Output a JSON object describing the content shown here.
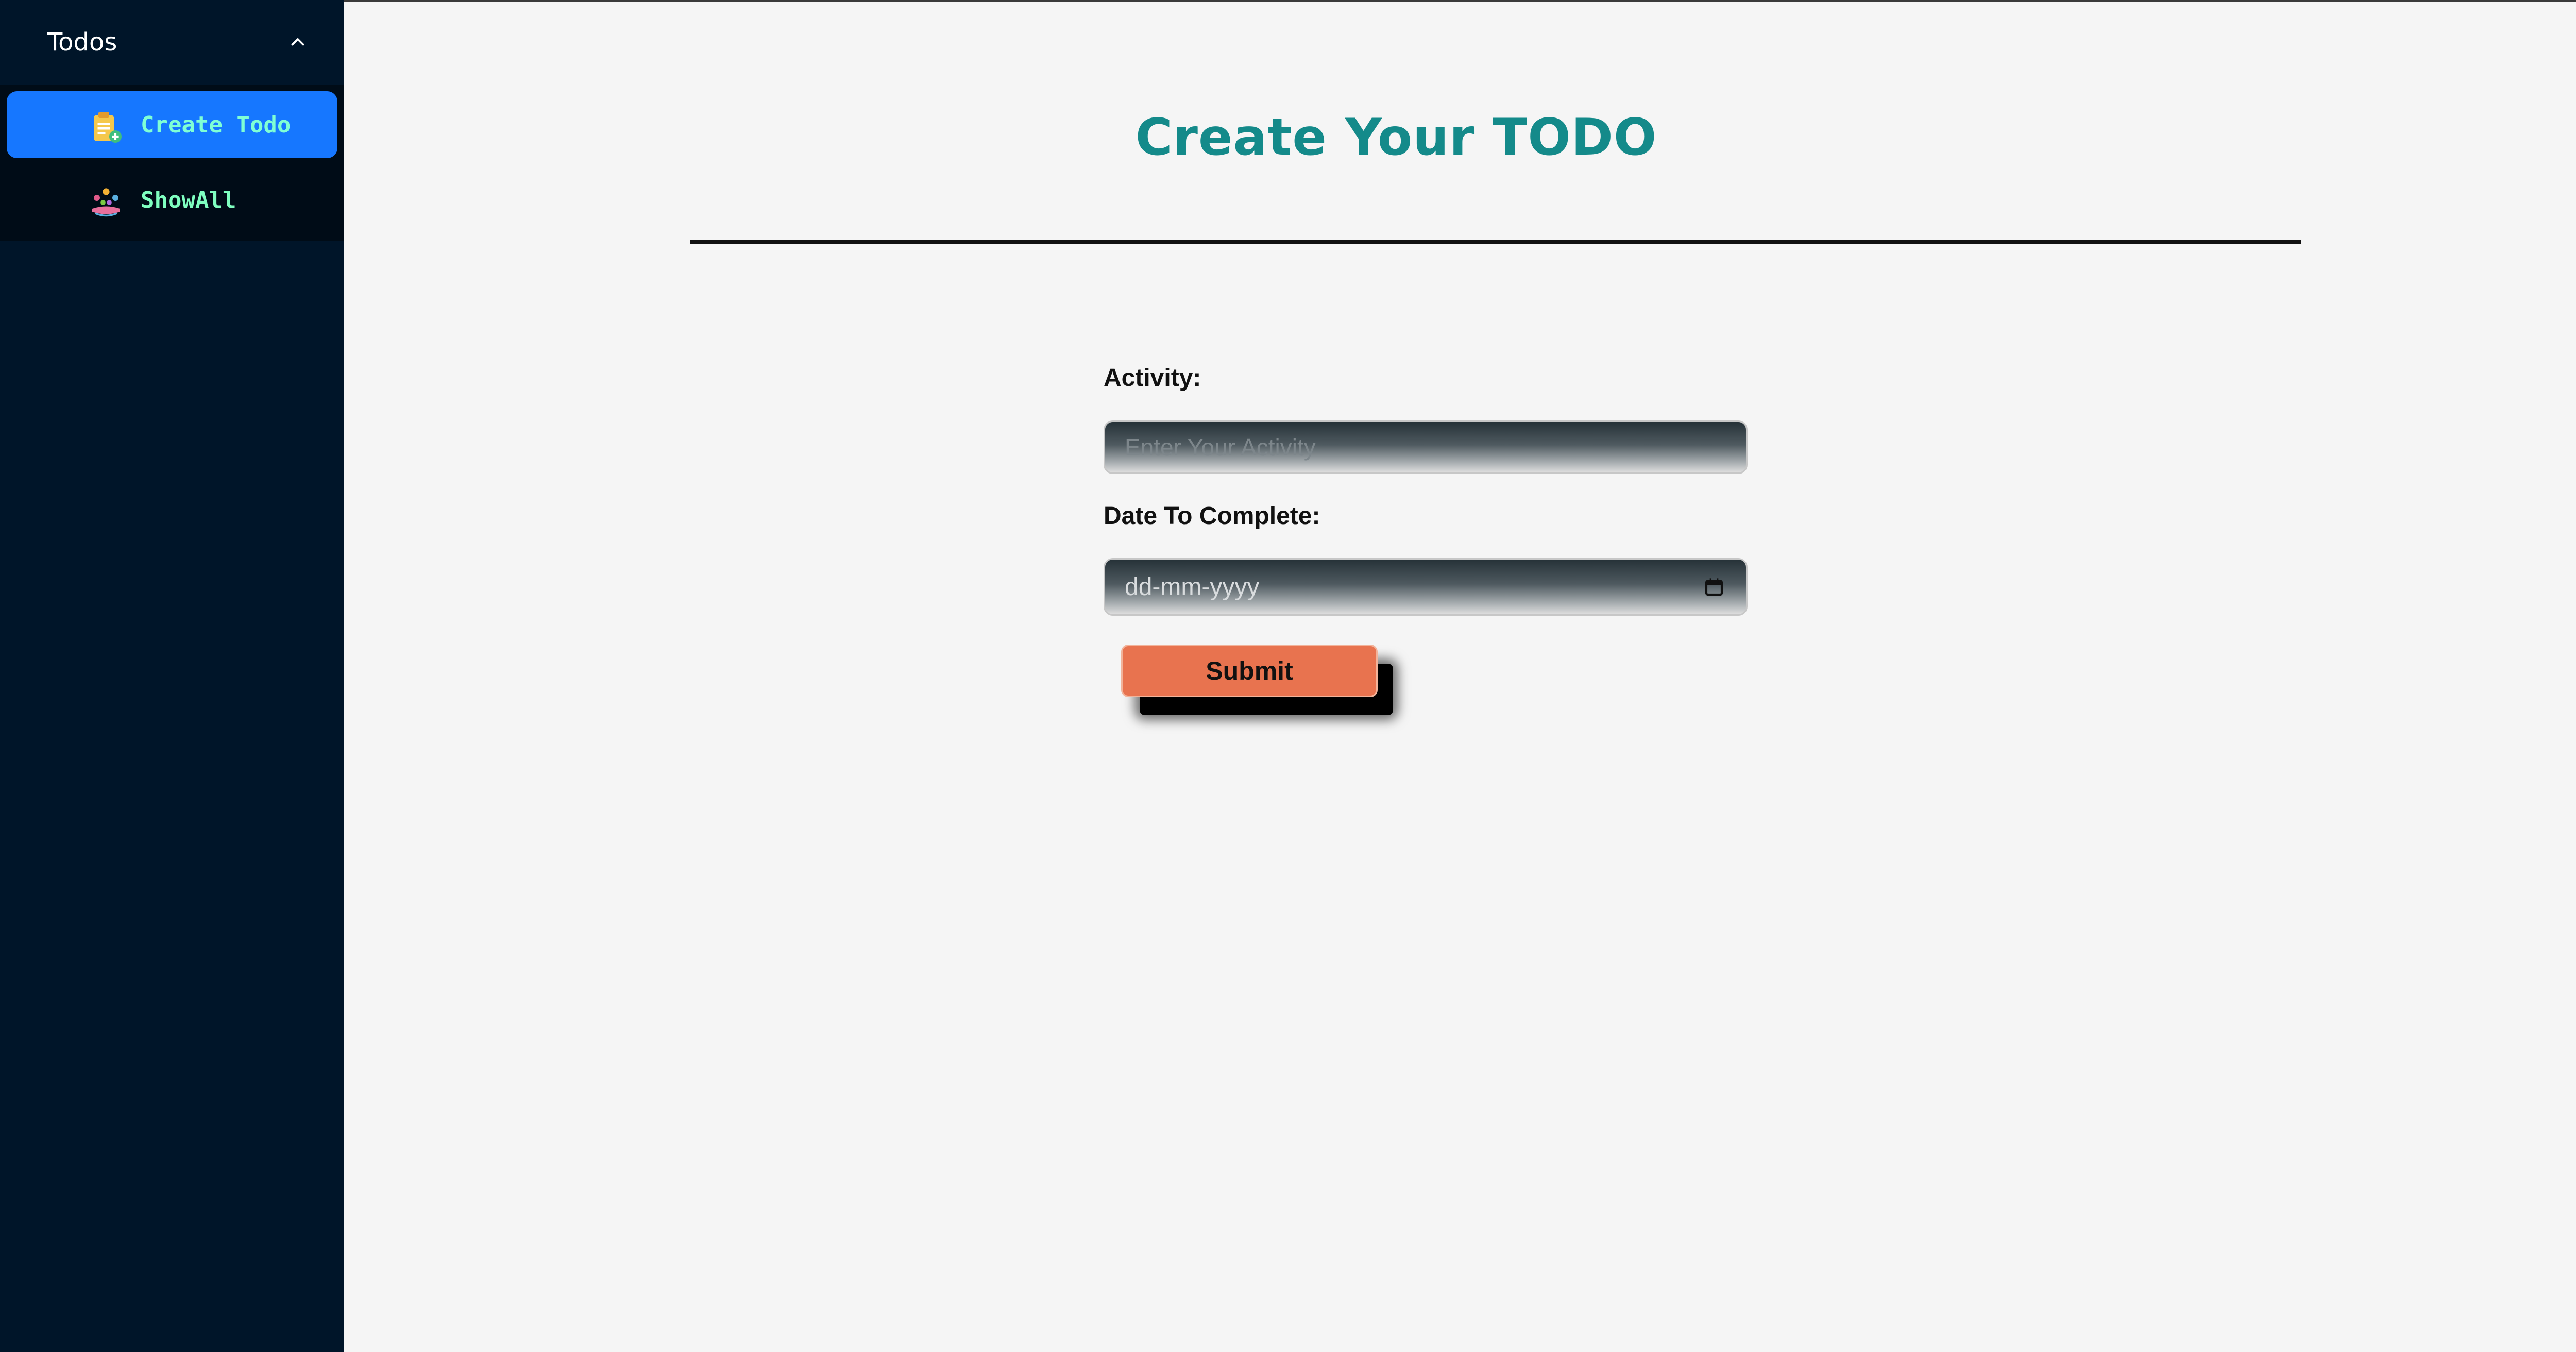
{
  "sidebar": {
    "submenu_title": "Todos",
    "items": [
      {
        "label": "Create Todo",
        "icon": "clipboard-add-icon",
        "active": true
      },
      {
        "label": "ShowAll",
        "icon": "people-list-icon",
        "active": false
      }
    ]
  },
  "main": {
    "title": "Create Your TODO",
    "form": {
      "activity_label": "Activity:",
      "activity_placeholder": "Enter Your Activity",
      "date_label": "Date To Complete:",
      "date_placeholder": "dd-mm-yyyy",
      "submit_label": "Submit"
    }
  },
  "colors": {
    "sidebar_bg": "#001529",
    "submenu_bg": "#000c17",
    "active_item": "#1677ff",
    "title": "#148a8a",
    "submit": "#e8734f"
  }
}
